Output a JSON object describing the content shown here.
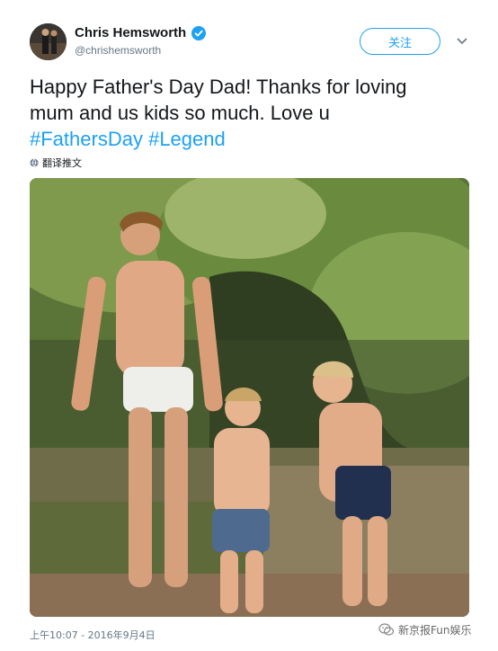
{
  "author": {
    "display_name": "Chris Hemsworth",
    "handle": "@chrishemsworth",
    "verified": true
  },
  "follow_button": {
    "label": "关注"
  },
  "tweet": {
    "text_line1": "Happy Father's Day Dad! Thanks for loving",
    "text_line2": "mum and us kids so much. Love u",
    "hashtags": [
      "#FathersDay",
      "#Legend"
    ],
    "translate_label": "翻译推文"
  },
  "timestamp": "上午10:07 - 2016年9月4日",
  "watermark": {
    "text": "新京报Fun娱乐"
  },
  "colors": {
    "accent": "#1da1f2",
    "text": "#14171a",
    "muted": "#657786"
  },
  "icons": {
    "verified": "verified-badge-icon",
    "caret": "chevron-down-icon",
    "translate": "globe-icon",
    "watermark": "wechat-icon"
  }
}
